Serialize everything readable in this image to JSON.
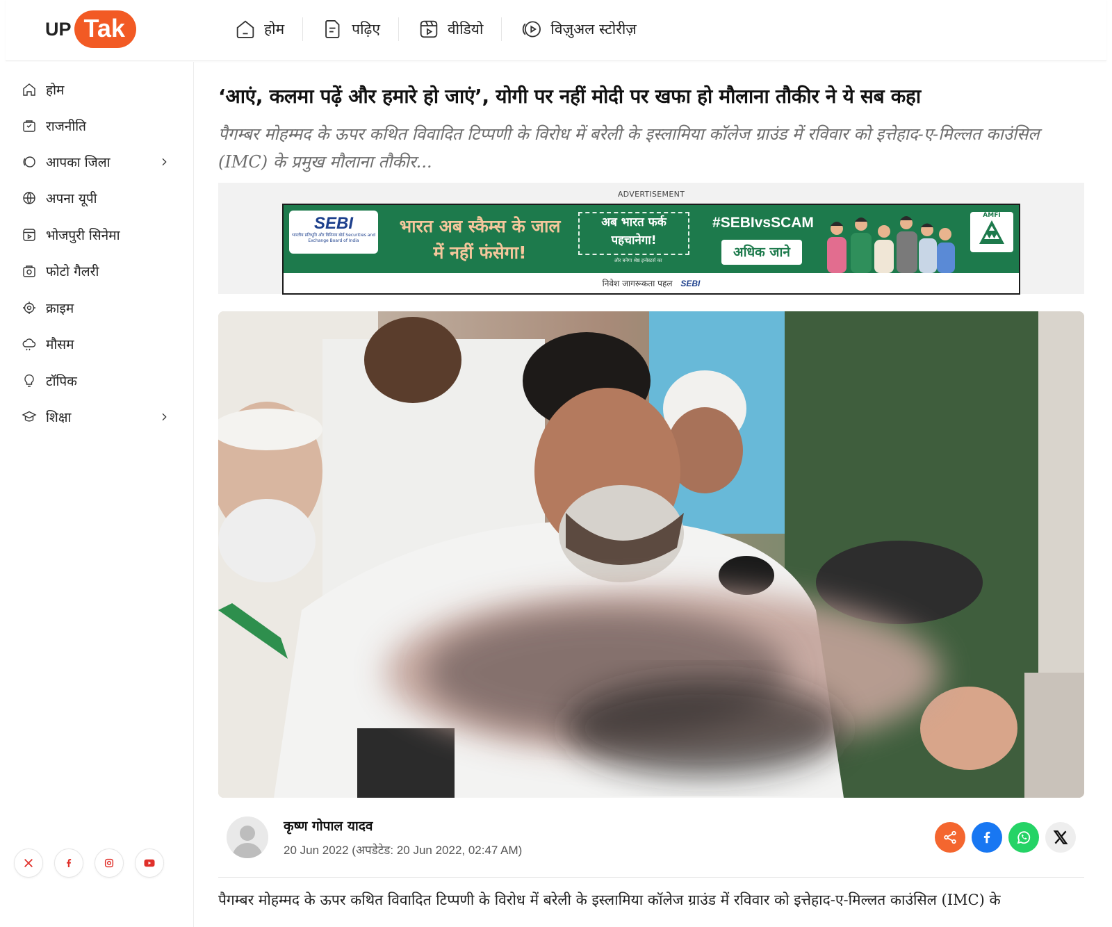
{
  "header": {
    "logo_up": "UP",
    "logo_tak": "Tak",
    "nav": [
      {
        "label": "होम",
        "icon": "home-icon"
      },
      {
        "label": "पढ़िए",
        "icon": "read-document-icon"
      },
      {
        "label": "वीडियो",
        "icon": "video-icon"
      },
      {
        "label": "विज़ुअल स्टोरीज़",
        "icon": "visual-stories-icon"
      }
    ]
  },
  "sidebar": {
    "items": [
      {
        "label": "होम",
        "icon": "home-icon"
      },
      {
        "label": "राजनीति",
        "icon": "politics-icon"
      },
      {
        "label": "आपका जिला",
        "icon": "district-icon",
        "has_submenu": true
      },
      {
        "label": "अपना यूपी",
        "icon": "globe-icon"
      },
      {
        "label": "भोजपुरी सिनेमा",
        "icon": "cinema-icon"
      },
      {
        "label": "फोटो गैलरी",
        "icon": "photo-gallery-icon"
      },
      {
        "label": "क्राइम",
        "icon": "crime-target-icon"
      },
      {
        "label": "मौसम",
        "icon": "weather-icon"
      },
      {
        "label": "टॉपिक",
        "icon": "topic-bulb-icon"
      },
      {
        "label": "शिक्षा",
        "icon": "education-icon",
        "has_submenu": true
      }
    ],
    "social": [
      "x-icon",
      "facebook-icon",
      "instagram-icon",
      "youtube-icon"
    ]
  },
  "article": {
    "headline": "‘आएं, कलमा पढ़ें और हमारे हो जाएं’, योगी पर नहीं मोदी पर खफा हो मौलाना तौकीर ने ये सब कहा",
    "summary": "पैगम्बर मोहम्मद के ऊपर कथित विवादित टिप्पणी के विरोध में बरेली के इस्लामिया कॉलेज ग्राउंड में रविवार को इत्तेहाद-ए-मिल्लत काउंसिल (IMC) के प्रमुख मौलाना तौकीर...",
    "author": "कृष्ण गोपाल यादव",
    "date": "20 Jun 2022 (अपडेटेड: 20 Jun 2022, 02:47 AM)",
    "body_first_line": "पैगम्बर मोहम्मद के ऊपर कथित विवादित टिप्पणी के विरोध में बरेली के इस्लामिया कॉलेज ग्राउंड में रविवार को इत्तेहाद-ए-मिल्लत काउंसिल (IMC) के"
  },
  "ad": {
    "label": "ADVERTISEMENT",
    "sebi": "SEBI",
    "sebi_sub": "भारतीय प्रतिभूति और विनिमय बोर्ड Securities and Exchange Board of India",
    "headline": "भारत अब स्कैम्स के जाल में नहीं फंसेगा!",
    "mid": "अब भारत फर्क पहचानेगा!",
    "mid_sub": "और बनेगा श्रेष्ठ इन्वेस्टर्स का",
    "hashtag": "#SEBIvsSCAM",
    "button": "अधिक जाने",
    "amfi": "AMFI",
    "footer": "निवेश जागरूकता पहल",
    "footer_logo": "SEBI"
  },
  "share": [
    "share-icon",
    "facebook-icon",
    "whatsapp-icon",
    "x-icon"
  ],
  "colors": {
    "brand": "#f25a24",
    "ad_green": "#1d7a4c",
    "facebook": "#1877f2",
    "whatsapp": "#25d366",
    "share": "#f4662f"
  }
}
